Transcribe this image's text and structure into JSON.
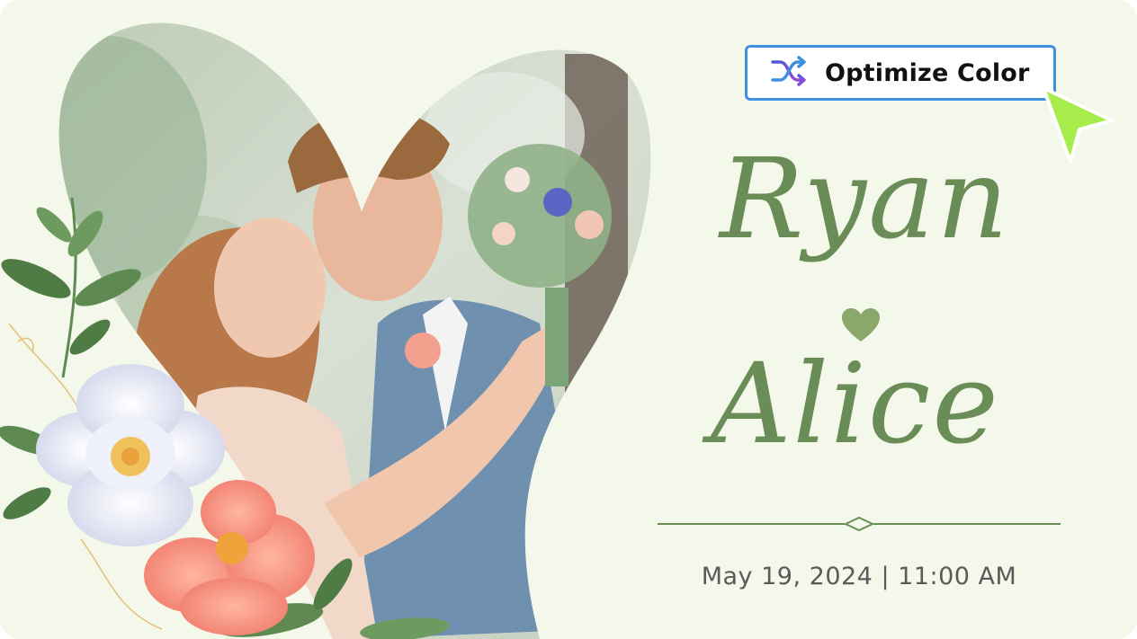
{
  "toolbar": {
    "optimize_label": "Optimize Color",
    "optimize_icon": "shuffle-icon"
  },
  "invitation": {
    "name_1": "Ryan",
    "name_2": "Alice",
    "date_time": "May 19, 2024 | 11:00 AM"
  },
  "colors": {
    "background": "#f4f8ea",
    "accent_green": "#6a8c56",
    "heart": "#8aa86a",
    "button_border": "#3f8fe0",
    "cursor": "#a6ec4a"
  }
}
